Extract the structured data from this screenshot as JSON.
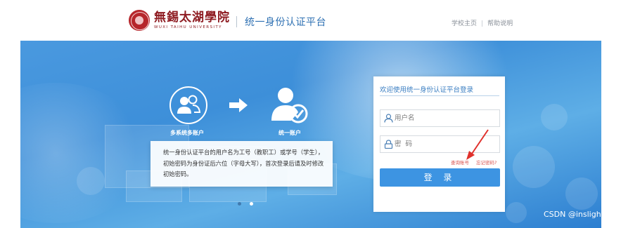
{
  "header": {
    "school_name_cn": "無錫太湖學院",
    "school_name_en": "WUXI TAIHU UNIVERSITY",
    "platform_title": "统一身份认证平台",
    "links": [
      "学校主页",
      "帮助说明"
    ],
    "link_separator": "|"
  },
  "banner": {
    "left_caption": "多系统多账户",
    "right_caption": "统一账户",
    "description_lines": [
      "统一身份认证平台的用户名为工号（教职工）或学号（学生），",
      "初始密码为身份证后六位（字母大写），首次登录后请及时修改",
      "初始密码。"
    ],
    "carousel": {
      "count": 2,
      "active_index": 1
    }
  },
  "login": {
    "title": "欢迎使用统一身份认证平台登录",
    "username_placeholder": "用户名",
    "password_placeholder": "密  码",
    "view_account": "查询账号",
    "forgot_password": "忘记密码?",
    "submit": "登 录"
  },
  "colors": {
    "accent": "#3d94e2",
    "title_blue": "#2f71b3",
    "school_red": "#8e1b21",
    "link_red": "#d9534f",
    "annotation_arrow": "#e0312c"
  },
  "watermark": "CSDN @inslight"
}
